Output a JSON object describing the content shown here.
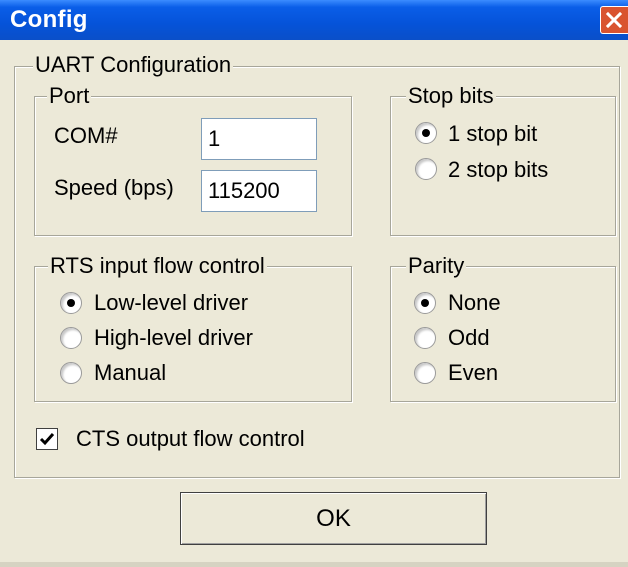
{
  "window": {
    "title": "Config"
  },
  "uart": {
    "legend": "UART Configuration",
    "port": {
      "legend": "Port",
      "com_label": "COM#",
      "com_value": "1",
      "speed_label": "Speed (bps)",
      "speed_value": "115200"
    },
    "stop_bits": {
      "legend": "Stop bits",
      "options": [
        {
          "label": "1 stop bit",
          "selected": true
        },
        {
          "label": "2 stop bits",
          "selected": false
        }
      ]
    },
    "rts": {
      "legend": "RTS input flow control",
      "options": [
        {
          "label": "Low-level driver",
          "selected": true
        },
        {
          "label": "High-level driver",
          "selected": false
        },
        {
          "label": "Manual",
          "selected": false
        }
      ]
    },
    "parity": {
      "legend": "Parity",
      "options": [
        {
          "label": "None",
          "selected": true
        },
        {
          "label": "Odd",
          "selected": false
        },
        {
          "label": "Even",
          "selected": false
        }
      ]
    },
    "cts": {
      "label": "CTS output flow control",
      "checked": true
    }
  },
  "buttons": {
    "ok": "OK"
  },
  "icons": {
    "close": "close-icon",
    "checkbox_check": "checkmark-icon"
  },
  "colors": {
    "titlebar": "#0553d9",
    "close": "#d9532f",
    "face": "#ece9d8"
  }
}
